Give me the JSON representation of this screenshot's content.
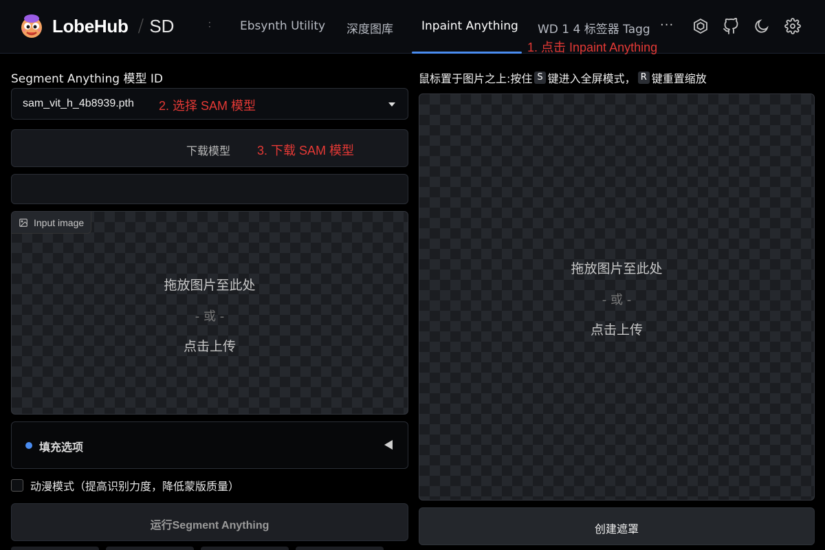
{
  "header": {
    "brand": "LobeHub",
    "separator": "/",
    "brand_sub": "SD",
    "tabs": [
      {
        "label": "Ebsynth Utility",
        "active": false
      },
      {
        "label": "深度图库",
        "active": false
      },
      {
        "label": "Inpaint Anything",
        "active": true
      },
      {
        "label": "WD 1 4 标签器 Tagg",
        "active": false
      }
    ],
    "more_label": "···",
    "icons": [
      "hexagon-icon",
      "github-icon",
      "moon-icon",
      "gear-icon"
    ],
    "accent_color": "#4a8cf0"
  },
  "annotations": {
    "step1": "1. 点击 Inpaint Anything",
    "step2": "2. 选择 SAM 模型",
    "step3": "3. 下载 SAM 模型",
    "color": "#e53935"
  },
  "left": {
    "model_label": "Segment Anything 模型 ID",
    "model_value": "sam_vit_h_4b8939.pth",
    "download_button": "下载模型",
    "input_image": {
      "chip": "Input image",
      "drop": "拖放图片至此处",
      "or": "- 或 -",
      "upload": "点击上传"
    },
    "accordion_label": "填充选项",
    "anime_mode_label": "动漫模式（提高识别力度，降低蒙版质量）",
    "anime_mode_checked": false,
    "run_button": "运行Segment Anything"
  },
  "right": {
    "hint_before_s": "鼠标置于图片之上:按住",
    "key_s": "S",
    "hint_mid": "键进入全屏模式，",
    "key_r": "R",
    "hint_after_r": "键重置缩放",
    "canvas": {
      "drop": "拖放图片至此处",
      "or": "- 或 -",
      "upload": "点击上传"
    },
    "create_mask_button": "创建遮罩"
  }
}
